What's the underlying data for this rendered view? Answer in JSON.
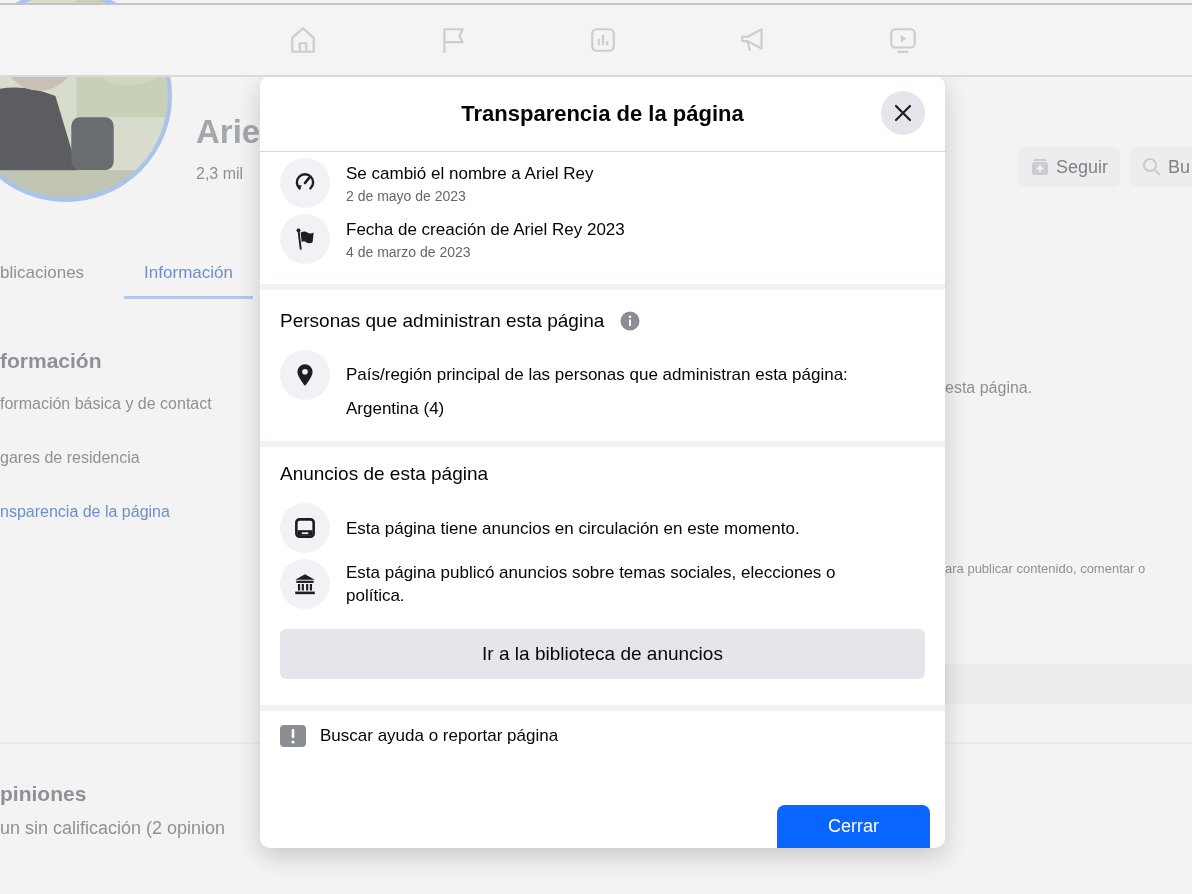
{
  "page": {
    "name": "Arie",
    "followers": "2,3 mil",
    "actions": [
      {
        "kind": "follow",
        "label": "Seguir"
      },
      {
        "kind": "search",
        "label": "Bu"
      }
    ],
    "tabs": [
      {
        "label": "blicaciones",
        "selected": false
      },
      {
        "label": "Información",
        "selected": true
      }
    ],
    "info": {
      "heading": "formación",
      "items": [
        {
          "label": "formación básica y de contact",
          "selected": false
        },
        {
          "label": "gares de residencia",
          "selected": false
        },
        {
          "label": "nsparencia de la página",
          "selected": true
        }
      ]
    },
    "right_texts": [
      "esta página.",
      "ara publicar contenido, comentar o"
    ],
    "reviews": {
      "heading": "piniones",
      "summary": "un sin calificación (2 opinion"
    }
  },
  "dialog": {
    "title": "Transparencia de la página",
    "history": [
      {
        "kind": "rename",
        "text": "Se cambió el nombre a Ariel Rey",
        "date": "2 de mayo de 2023"
      },
      {
        "kind": "created",
        "text": "Fecha de creación de Ariel Rey 2023",
        "date": "4 de marzo de 2023"
      }
    ],
    "admins": {
      "heading": "Personas que administran esta página",
      "items": [
        {
          "kind": "location",
          "text": "País/región principal de las personas que administran esta página:",
          "value": "Argentina (4)"
        }
      ]
    },
    "ads": {
      "heading": "Anuncios de esta página",
      "items": [
        {
          "kind": "monitor",
          "text": "Esta página tiene anuncios en circulación en este momento."
        },
        {
          "kind": "building",
          "text": "Esta página publicó anuncios sobre temas sociales, elecciones o política."
        }
      ],
      "button": "Ir a la biblioteca de anuncios"
    },
    "report": "Buscar ayuda o reportar página",
    "close_button": "Cerrar"
  }
}
